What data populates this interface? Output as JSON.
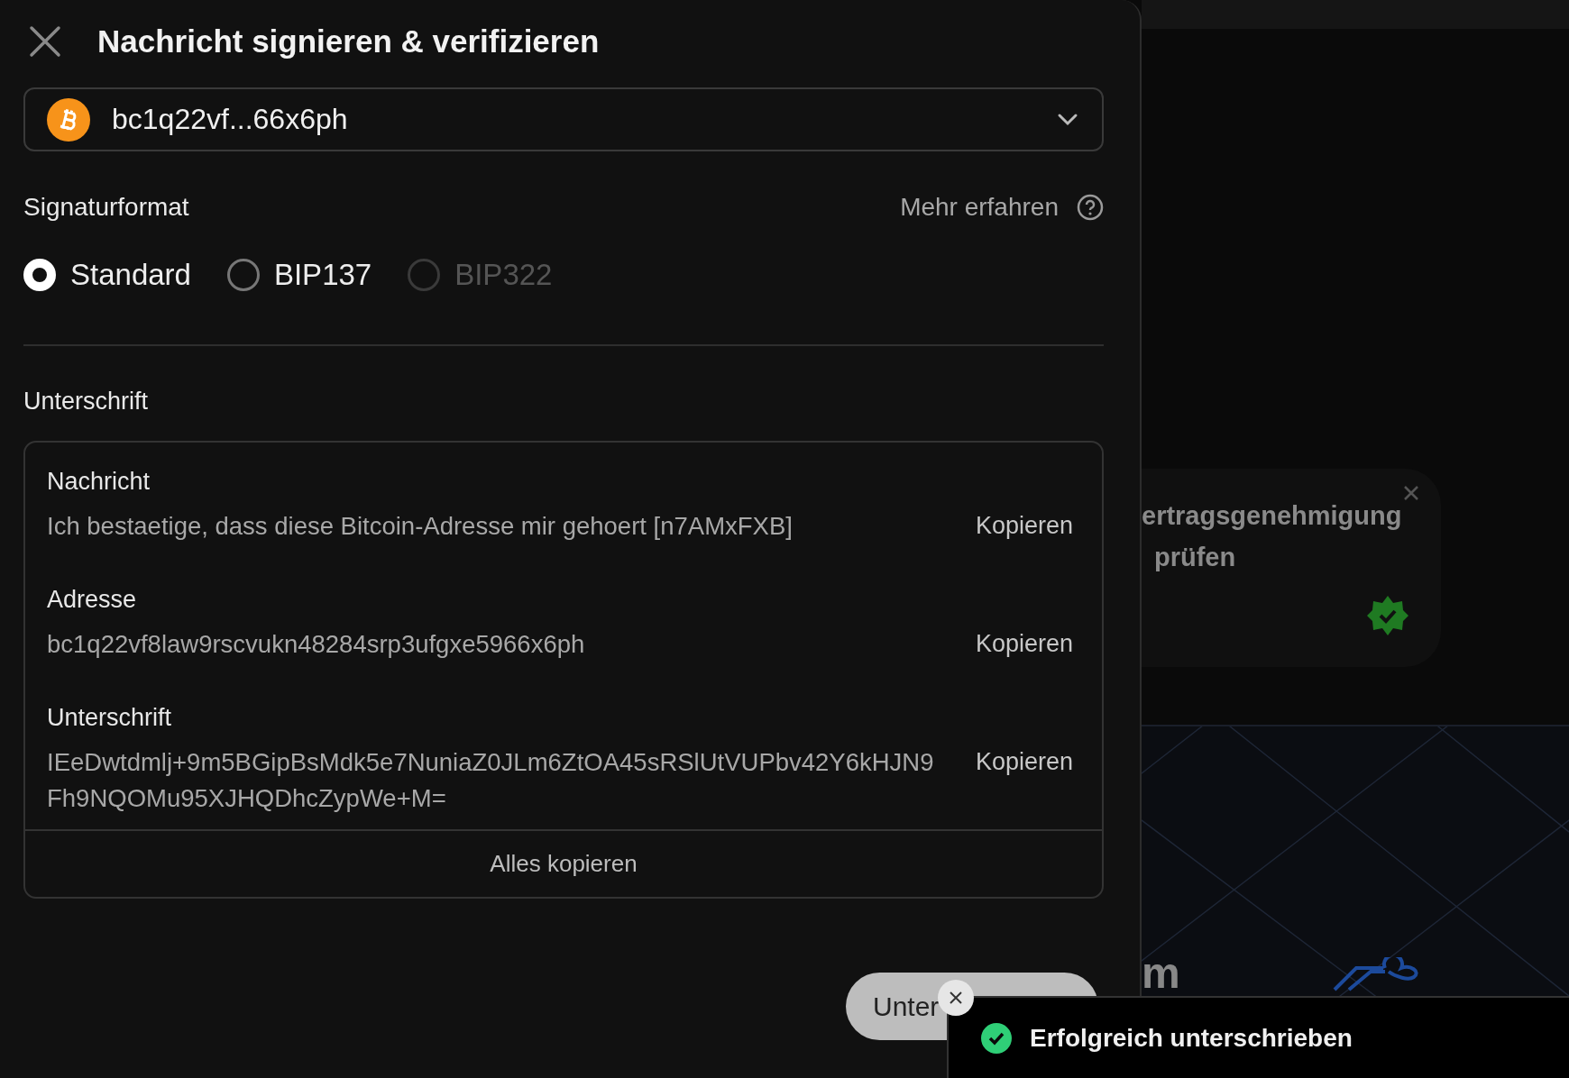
{
  "dialog": {
    "title": "Nachricht signieren & verifizieren"
  },
  "address_select": {
    "value": "bc1q22vf...66x6ph"
  },
  "signature_format": {
    "label": "Signaturformat",
    "learn_more": "Mehr erfahren",
    "options": [
      {
        "label": "Standard",
        "selected": true,
        "disabled": false
      },
      {
        "label": "BIP137",
        "selected": false,
        "disabled": false
      },
      {
        "label": "BIP322",
        "selected": false,
        "disabled": true
      }
    ]
  },
  "result": {
    "heading": "Unterschrift",
    "fields": [
      {
        "label": "Nachricht",
        "value": "Ich bestaetige, dass diese Bitcoin-Adresse mir gehoert [n7AMxFXB]",
        "copy": "Kopieren"
      },
      {
        "label": "Adresse",
        "value": "bc1q22vf8law9rscvukn48284srp3ufgxe5966x6ph",
        "copy": "Kopieren"
      },
      {
        "label": "Unterschrift",
        "value": "IEeDwtdmlj+9m5BGipBsMdk5e7NuniaZ0JLm6ZtOA45sRSlUtVUPbv42Y6kHJN9Fh9NQOMu95XJHQDhcZypWe+M=",
        "copy": "Kopieren"
      }
    ],
    "copy_all": "Alles kopieren"
  },
  "submit_button": "Unter",
  "background": {
    "card_lines": [
      "ertragsgenehmigung",
      "prüfen"
    ],
    "banner_text": "m"
  },
  "toast": {
    "message": "Erfolgreich unterschrieben"
  }
}
